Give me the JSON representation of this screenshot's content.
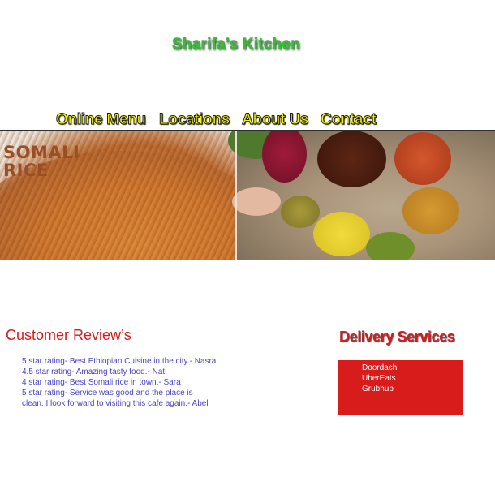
{
  "site": {
    "title": "Sharifa’s Kitchen"
  },
  "nav": {
    "items": [
      {
        "label": "Online Menu"
      },
      {
        "label": "Locations"
      },
      {
        "label": "About Us"
      },
      {
        "label": "Contact"
      }
    ]
  },
  "banner": {
    "left_text_line1": "SOMALI",
    "left_text_line2": "RICE"
  },
  "reviews": {
    "title": "Customer Review’s",
    "items": [
      "5 star rating- Best Ethiopian Cuisine in the city.- Nasra",
      "4.5 star rating- Amazing tasty food.- Nati",
      "4 star rating- Best Somali rice in town.- Sara",
      "5 star rating-  Service was good and the place is clean. I look forward to visiting this cafe again.- Abel"
    ]
  },
  "delivery": {
    "title": "Delivery Services",
    "items": [
      "Doordash",
      "UberEats",
      "Grubhub"
    ]
  },
  "colors": {
    "title_green": "#2ec42e",
    "nav_yellow": "#f4f000",
    "heading_red": "#d61b1b",
    "delivery_box": "#d81b1b",
    "review_text": "#4b44c8"
  }
}
